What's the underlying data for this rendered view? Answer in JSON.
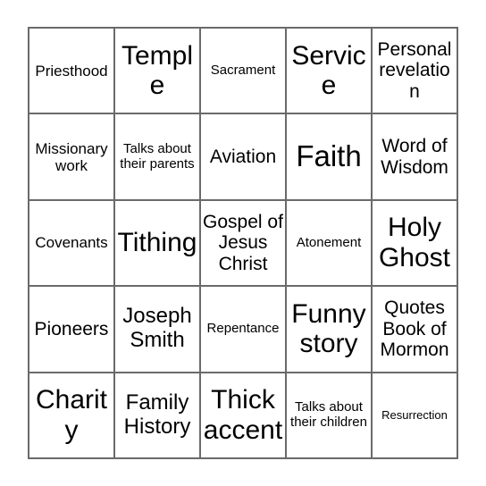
{
  "card": {
    "type": "bingo-card",
    "rows": 5,
    "columns": 5,
    "border_color": "#6a6a6a",
    "background_color": "#ffffff",
    "text_color": "#000000",
    "cells": [
      [
        {
          "text": "Priesthood",
          "size": "m"
        },
        {
          "text": "Temple",
          "size": "xxl"
        },
        {
          "text": "Sacrament",
          "size": "s"
        },
        {
          "text": "Service",
          "size": "xxl"
        },
        {
          "text": "Personal revelation",
          "size": "l"
        }
      ],
      [
        {
          "text": "Missionary work",
          "size": "m"
        },
        {
          "text": "Talks about their parents",
          "size": "s"
        },
        {
          "text": "Aviation",
          "size": "l"
        },
        {
          "text": "Faith",
          "size": "huge"
        },
        {
          "text": "Word of Wisdom",
          "size": "l"
        }
      ],
      [
        {
          "text": "Covenants",
          "size": "m"
        },
        {
          "text": "Tithing",
          "size": "xxl"
        },
        {
          "text": "Gospel of Jesus Christ",
          "size": "l"
        },
        {
          "text": "Atonement",
          "size": "s"
        },
        {
          "text": "Holy Ghost",
          "size": "xxl"
        }
      ],
      [
        {
          "text": "Pioneers",
          "size": "l"
        },
        {
          "text": "Joseph Smith",
          "size": "xl"
        },
        {
          "text": "Repentance",
          "size": "s"
        },
        {
          "text": "Funny story",
          "size": "xxl"
        },
        {
          "text": "Quotes Book of Mormon",
          "size": "l"
        }
      ],
      [
        {
          "text": "Charity",
          "size": "xxl"
        },
        {
          "text": "Family History",
          "size": "xl"
        },
        {
          "text": "Thick accent",
          "size": "xxl"
        },
        {
          "text": "Talks about their children",
          "size": "s"
        },
        {
          "text": "Resurrection",
          "size": "xs"
        }
      ]
    ]
  }
}
